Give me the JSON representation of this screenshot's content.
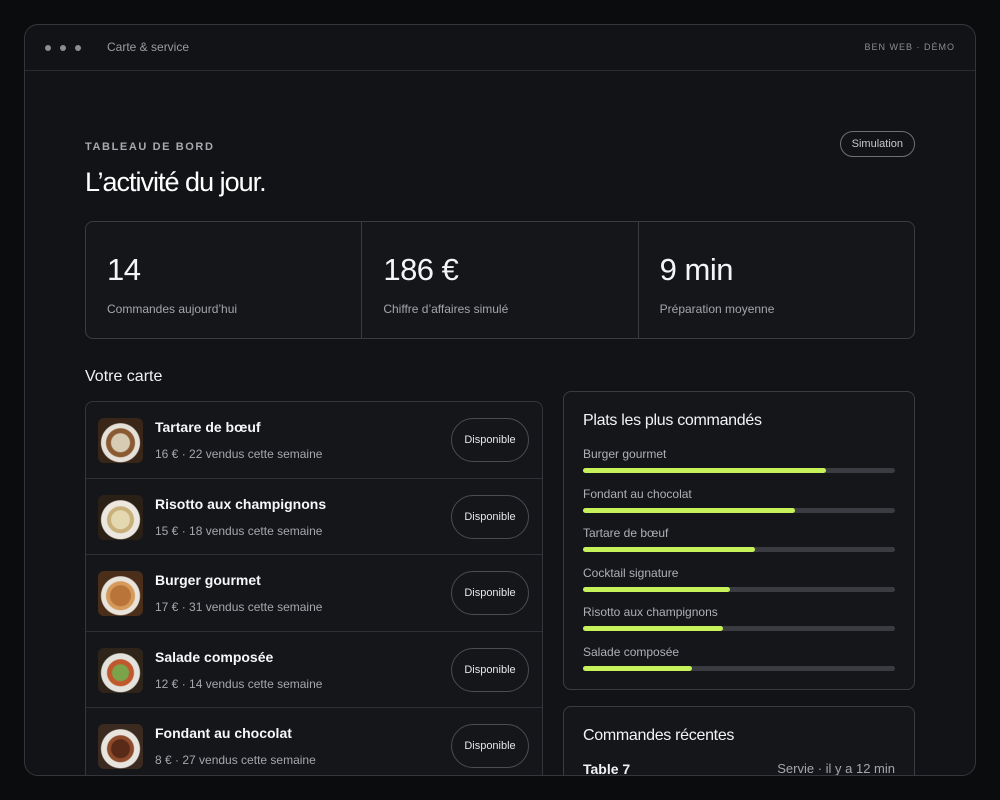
{
  "window": {
    "title": "Carte & service",
    "brand": "BEN WEB · DÉMO"
  },
  "header": {
    "eyebrow": "TABLEAU DE BORD",
    "title": "L’activité du jour.",
    "badge": "Simulation"
  },
  "stats": [
    {
      "value": "14",
      "label": "Commandes aujourd’hui"
    },
    {
      "value": "186 €",
      "label": "Chiffre d’affaires simulé"
    },
    {
      "value": "9 min",
      "label": "Préparation moyenne"
    }
  ],
  "menu": {
    "title": "Votre carte",
    "items": [
      {
        "name": "Tartare de bœuf",
        "meta": "16 € · 22 vendus cette semaine",
        "status": "Disponible"
      },
      {
        "name": "Risotto aux champignons",
        "meta": "15 € · 18 vendus cette semaine",
        "status": "Disponible"
      },
      {
        "name": "Burger gourmet",
        "meta": "17 € · 31 vendus cette semaine",
        "status": "Disponible"
      },
      {
        "name": "Salade composée",
        "meta": "12 € · 14 vendus cette semaine",
        "status": "Disponible"
      },
      {
        "name": "Fondant au chocolat",
        "meta": "8 € · 27 vendus cette semaine",
        "status": "Disponible"
      }
    ]
  },
  "top_dishes": {
    "title": "Plats les plus commandés",
    "accent": "#c8f25a",
    "items": [
      {
        "label": "Burger gourmet",
        "pct": 78
      },
      {
        "label": "Fondant au chocolat",
        "pct": 68
      },
      {
        "label": "Tartare de bœuf",
        "pct": 55
      },
      {
        "label": "Cocktail signature",
        "pct": 47
      },
      {
        "label": "Risotto aux champignons",
        "pct": 45
      },
      {
        "label": "Salade composée",
        "pct": 35
      }
    ]
  },
  "recent_orders": {
    "title": "Commandes récentes",
    "items": [
      {
        "table": "Table 7",
        "status": "Servie · il y a 12 min"
      }
    ]
  }
}
